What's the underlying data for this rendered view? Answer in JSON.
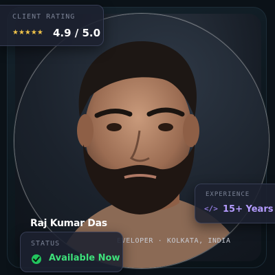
{
  "rating": {
    "label": "CLIENT RATING",
    "stars": "★★★★★",
    "value": "4.9 / 5.0",
    "star_count": 5
  },
  "profile": {
    "name": "Raj Kumar Das",
    "role_prefix": "",
    "role": "EVELOPER · KOLKATA, INDIA"
  },
  "experience": {
    "label": "EXPERIENCE",
    "icon": "code-icon",
    "value": "15+ Years"
  },
  "status": {
    "label": "STATUS",
    "icon": "check-circle-icon",
    "value": "Available Now",
    "color": "#22c55e"
  },
  "colors": {
    "accent_purple": "#b49bff",
    "accent_green": "#3ee07a",
    "star": "#f0c34a"
  }
}
